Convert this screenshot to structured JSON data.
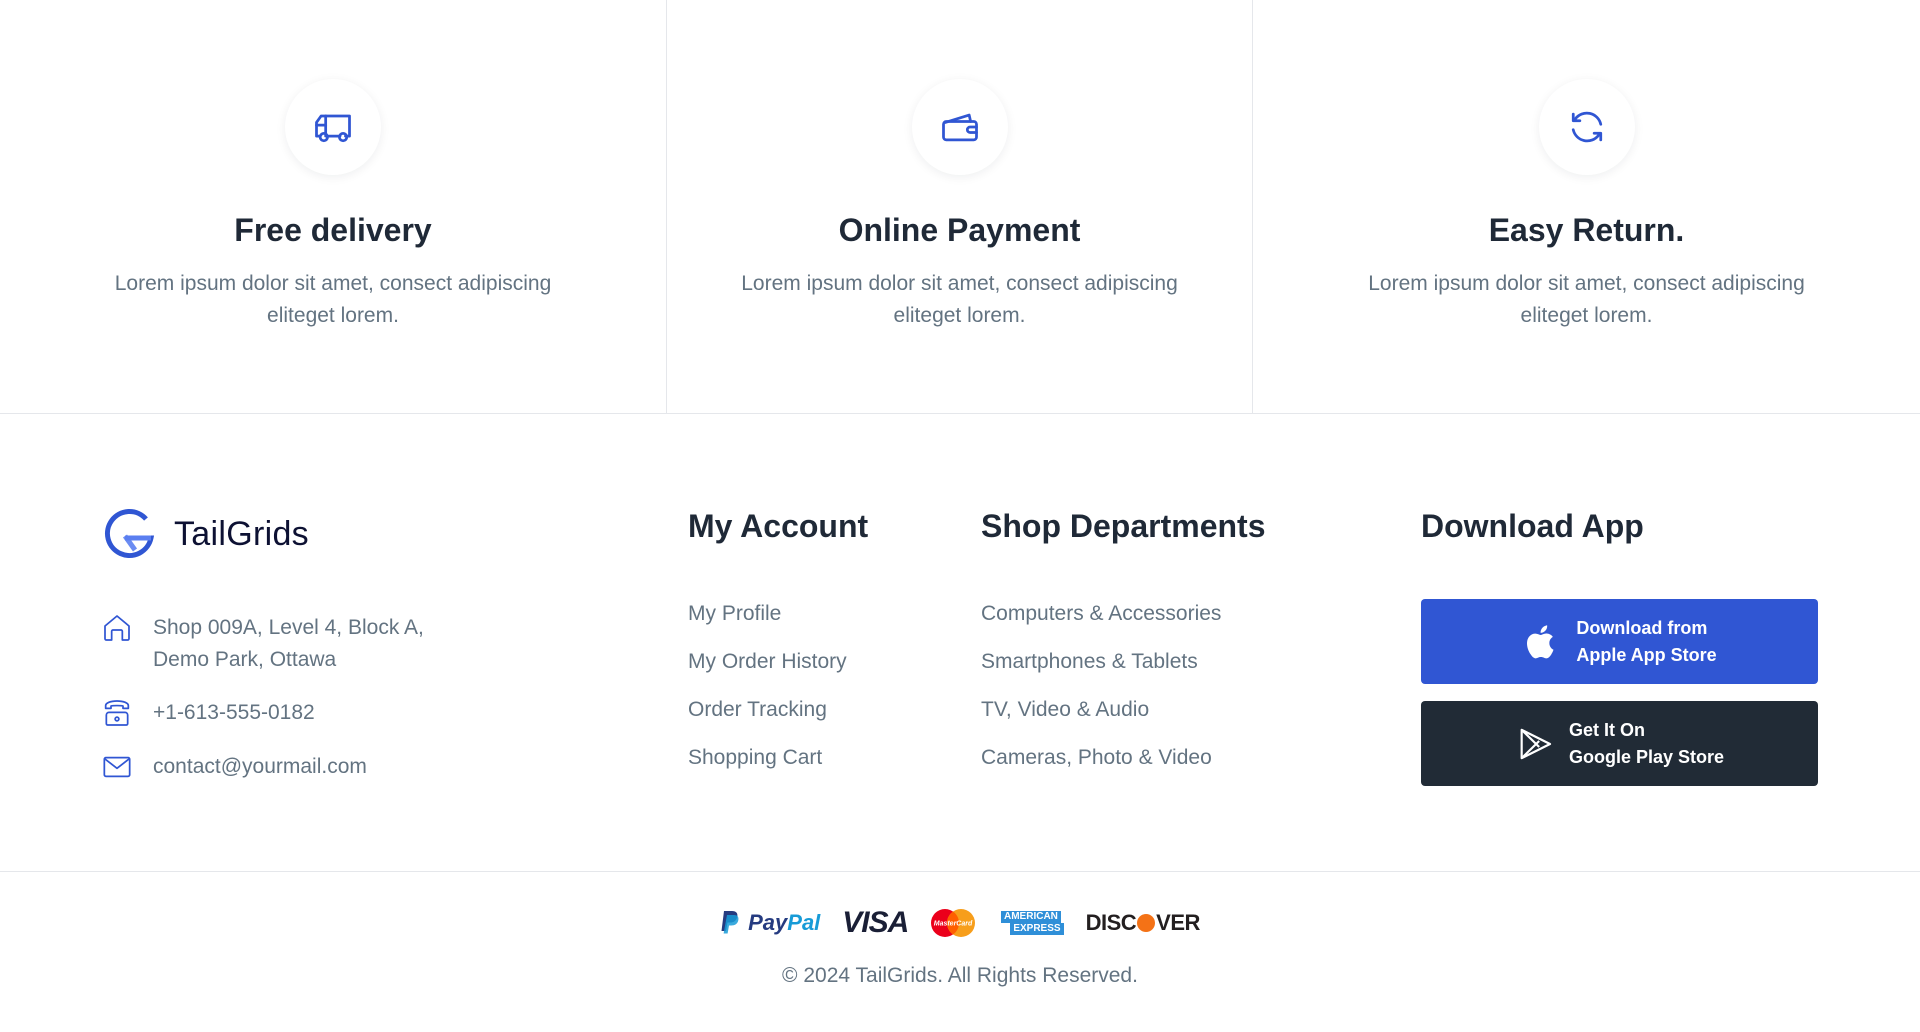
{
  "colors": {
    "primary": "#3056d3",
    "dark": "#212b36",
    "heading": "#1f2937",
    "body_text": "#637381",
    "border": "#e5e7eb"
  },
  "features": [
    {
      "icon": "truck-icon",
      "title": "Free delivery",
      "description": "Lorem ipsum dolor sit amet, consect adipiscing eliteget lorem."
    },
    {
      "icon": "wallet-icon",
      "title": "Online Payment",
      "description": "Lorem ipsum dolor sit amet, consect adipiscing eliteget lorem."
    },
    {
      "icon": "refresh-icon",
      "title": "Easy Return.",
      "description": "Lorem ipsum dolor sit amet, consect adipiscing eliteget lorem."
    }
  ],
  "footer": {
    "brand": {
      "name": "TailGrids",
      "icon": "tailgrids-logo-icon"
    },
    "contact": {
      "address_line1": "Shop 009A, Level 4, Block A,",
      "address_line2": "Demo Park, Ottawa",
      "phone": "+1-613-555-0182",
      "email": "contact@yourmail.com"
    },
    "my_account": {
      "heading": "My Account",
      "links": [
        "My Profile",
        "My Order History",
        "Order Tracking",
        "Shopping Cart"
      ]
    },
    "shop_departments": {
      "heading": "Shop Departments",
      "links": [
        "Computers & Accessories",
        "Smartphones & Tablets",
        "TV, Video & Audio",
        "Cameras, Photo & Video"
      ]
    },
    "download_app": {
      "heading": "Download App",
      "apple": {
        "line1": "Download from",
        "line2": "Apple App Store",
        "icon": "apple-icon"
      },
      "google": {
        "line1": "Get It On",
        "line2": "Google Play Store",
        "icon": "play-store-icon"
      }
    }
  },
  "bottom": {
    "payments": {
      "paypal_a": "Pay",
      "paypal_b": "Pal",
      "visa": "VISA",
      "mastercard": "MasterCard",
      "amex_1": "AMERICAN",
      "amex_2": "EXPRESS",
      "discover_a": "DISC",
      "discover_b": "VER"
    },
    "copyright": "© 2024 TailGrids. All Rights Reserved."
  }
}
